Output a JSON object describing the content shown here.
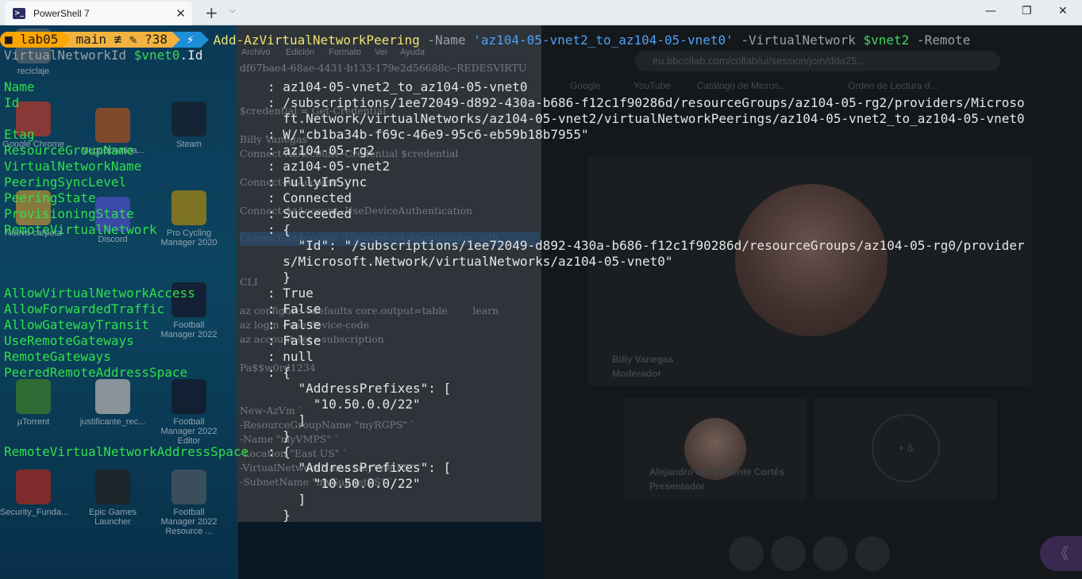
{
  "window": {
    "tab_title": "PowerShell 7",
    "tab_close": "✕",
    "new_tab": "+",
    "tab_dropdown": "⌵",
    "minimize": "—",
    "restore": "❐",
    "close": "✕"
  },
  "prompt": {
    "dir": "lab05",
    "git": "main ≢ ✎ ?38",
    "bolt": "⚡",
    "command": "Add-AzVirtualNetworkPeering",
    "p_name": "-Name",
    "name_value": "'az104-05-vnet2_to_az104-05-vnet0'",
    "p_vnet": "-VirtualNetwork",
    "vnet_var": "$vnet2",
    "p_remote": "-Remote",
    "line2_a": "VirtualNetworkId",
    "line2_var": "$vnet0",
    "line2_b": ".Id"
  },
  "output": {
    "labels": [
      {
        "text": "Name",
        "row": 0
      },
      {
        "text": "Id",
        "row": 1
      },
      {
        "text": "Etag",
        "row": 3
      },
      {
        "text": "ResourceGroupName",
        "row": 4
      },
      {
        "text": "VirtualNetworkName",
        "row": 5
      },
      {
        "text": "PeeringSyncLevel",
        "row": 6
      },
      {
        "text": "PeeringState",
        "row": 7
      },
      {
        "text": "ProvisioningState",
        "row": 8
      },
      {
        "text": "RemoteVirtualNetwork",
        "row": 9
      },
      {
        "text": "AllowVirtualNetworkAccess",
        "row": 13
      },
      {
        "text": "AllowForwardedTraffic",
        "row": 14
      },
      {
        "text": "AllowGatewayTransit",
        "row": 15
      },
      {
        "text": "UseRemoteGateways",
        "row": 16
      },
      {
        "text": "RemoteGateways",
        "row": 17
      },
      {
        "text": "PeeredRemoteAddressSpace",
        "row": 18
      },
      {
        "text": "RemoteVirtualNetworkAddressSpace",
        "row": 23
      }
    ],
    "values": [
      {
        "row": 0,
        "text": ": az104-05-vnet2_to_az104-05-vnet0"
      },
      {
        "row": 1,
        "text": ": /subscriptions/1ee72049-d892-430a-b686-f12c1f90286d/resourceGroups/az104-05-rg2/providers/Microso"
      },
      {
        "row": 2,
        "text": "  ft.Network/virtualNetworks/az104-05-vnet2/virtualNetworkPeerings/az104-05-vnet2_to_az104-05-vnet0"
      },
      {
        "row": 3,
        "text": ": W/\"cb1ba34b-f69c-46e9-95c6-eb59b18b7955\""
      },
      {
        "row": 4,
        "text": ": az104-05-rg2"
      },
      {
        "row": 5,
        "text": ": az104-05-vnet2"
      },
      {
        "row": 6,
        "text": ": FullyInSync"
      },
      {
        "row": 7,
        "text": ": Connected"
      },
      {
        "row": 8,
        "text": ": Succeeded"
      },
      {
        "row": 9,
        "text": ": {"
      },
      {
        "row": 10,
        "text": "    \"Id\": \"/subscriptions/1ee72049-d892-430a-b686-f12c1f90286d/resourceGroups/az104-05-rg0/provider"
      },
      {
        "row": 11,
        "text": "  s/Microsoft.Network/virtualNetworks/az104-05-vnet0\""
      },
      {
        "row": 12,
        "text": "  }"
      },
      {
        "row": 13,
        "text": ": True"
      },
      {
        "row": 14,
        "text": ": False"
      },
      {
        "row": 15,
        "text": ": False"
      },
      {
        "row": 16,
        "text": ": False"
      },
      {
        "row": 17,
        "text": ": null"
      },
      {
        "row": 18,
        "text": ": {"
      },
      {
        "row": 19,
        "text": "    \"AddressPrefixes\": ["
      },
      {
        "row": 20,
        "text": "      \"10.50.0.0/22\""
      },
      {
        "row": 21,
        "text": "    ]"
      },
      {
        "row": 22,
        "text": "  }"
      },
      {
        "row": 23,
        "text": ": {"
      },
      {
        "row": 24,
        "text": "    \"AddressPrefixes\": ["
      },
      {
        "row": 25,
        "text": "      \"10.50.0.0/22\""
      },
      {
        "row": 26,
        "text": "    ]"
      },
      {
        "row": 27,
        "text": "  }"
      }
    ]
  },
  "background": {
    "desktop_icons": [
      {
        "label": "reciclaje",
        "color": "#6b7f8a"
      },
      {
        "label": "Google Chrome",
        "color": "#d9483b"
      },
      {
        "label": "MegaDownloa...",
        "color": "#c9662a"
      },
      {
        "label": "Steam",
        "color": "#1b2838"
      },
      {
        "label": "Nueva carpeta",
        "color": "#d8b04a"
      },
      {
        "label": "Discord",
        "color": "#5865f2"
      },
      {
        "label": "Pro Cycling Manager 2020",
        "color": "#c7a71b"
      },
      {
        "label": "Football Manager 2022",
        "color": "#1b2136"
      },
      {
        "label": "µTorrent",
        "color": "#4a9a3a"
      },
      {
        "label": "justificante_rec...",
        "color": "#dcdcdc"
      },
      {
        "label": "Football Manager 2022 Editor",
        "color": "#1b2136"
      },
      {
        "label": "Security_Funda...",
        "color": "#c8362c"
      },
      {
        "label": "Epic Games Launcher",
        "color": "#2a2a2a"
      },
      {
        "label": "Football Manager 2022 Resource ...",
        "color": "#5a6d7a"
      }
    ],
    "notepad": {
      "menu": [
        "Archivo",
        "Edición",
        "Formato",
        "Ver",
        "Ayuda"
      ],
      "lines": [
        "df67bae4-68ae-4431-b133-179e2d56688c--REDESVIRTU",
        "$credential = Get-Credential",
        "Billy Vanegas",
        "Connect-AzAccount -Credential $credential",
        "Connect-AzAccount",
        "Connect-AzAccount -UseDeviceAuthentication",
        "Connect-AzAccount -UseDeviceAuthentication -Sub",
        "CLI",
        "az configure --defaults core.output=table        learn",
        "az login --use-device-code",
        "az account set --subscription",
        "Pa$$w0rd1234",
        "New-AzVm `",
        "-ResourceGroupName \"myRGPS\" `",
        "-Name \"myVMPS\" `",
        "-Location \"East US\" `",
        "-VirtualNetworkName \"myVnetPS\" `",
        "-SubnetName \"mySubnetPS\" `"
      ]
    },
    "meeting": {
      "url": "eu.bbcollab.com/collab/ui/session/join/dda25...",
      "bookmarks": [
        "Google",
        "YouTube",
        "Catálogo de Micros...",
        "Orden de Lectura d..."
      ],
      "moderator_name": "Billy Vanegas",
      "moderator_role": "Moderador",
      "presenter_name": "Alejandro de la Fuente Cortés",
      "presenter_role": "Presentador",
      "more_count": "+ 6",
      "side_toggle": "《"
    }
  },
  "colors": {
    "terminal_label": "#2fe04a",
    "terminal_value": "#e6e6e6",
    "command": "#f2e26d",
    "string": "#4ea1f3",
    "variable": "#41d65c",
    "prompt_dir": "#ffa500",
    "prompt_git": "#f2b23f",
    "prompt_bolt": "#1f8ed8"
  }
}
